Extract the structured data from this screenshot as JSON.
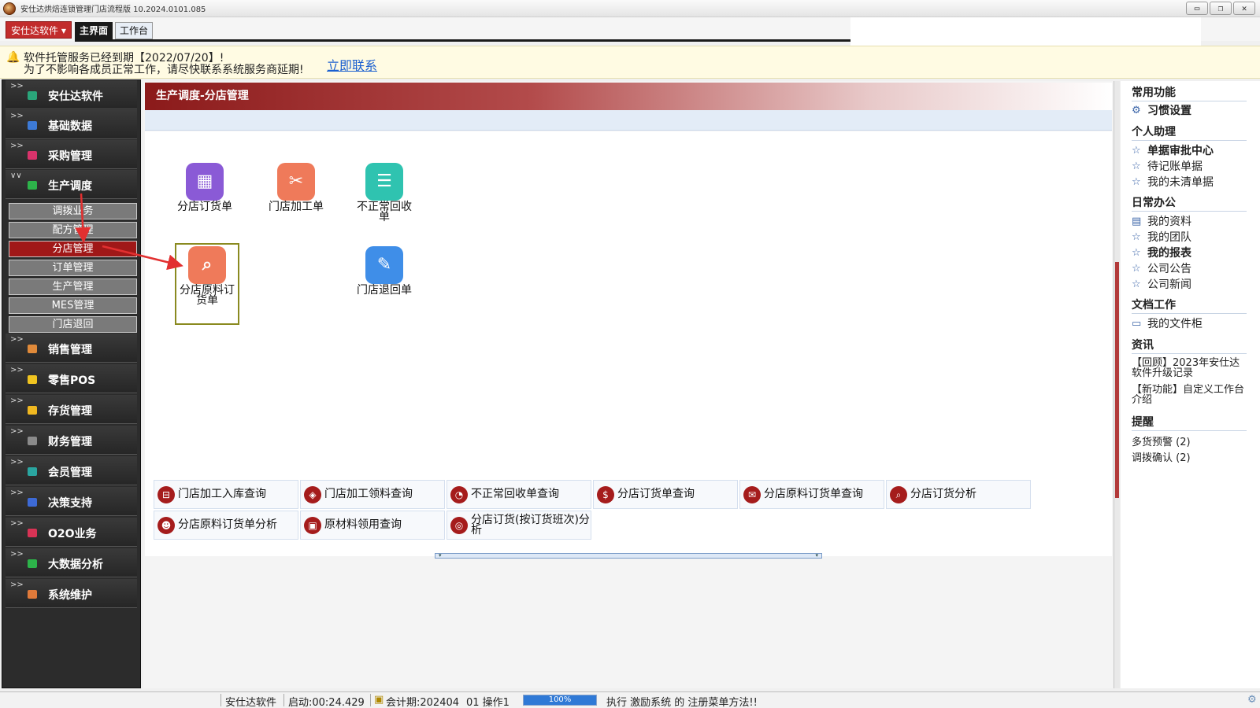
{
  "window": {
    "title": "安仕达烘焙连锁管理门店流程版  10.2024.0101.085",
    "controls": {
      "minimize": "▭",
      "restore": "❐",
      "close": "✕"
    }
  },
  "tabbar": {
    "brand_button": "安仕达软件 ▾",
    "tabs": [
      "主界面",
      "工作台"
    ]
  },
  "notice": {
    "line1": "软件托管服务已经到期【2022/07/20】!",
    "line2": "为了不影响各成员正常工作，请尽快联系系统服务商延期!",
    "link": "立即联系"
  },
  "sidebar": {
    "items": [
      {
        "label": "安仕达软件",
        "color": "#2aa57a"
      },
      {
        "label": "基础数据",
        "color": "#3d7ad6"
      },
      {
        "label": "采购管理",
        "color": "#d8336b"
      },
      {
        "label": "生产调度",
        "color": "#2db34a"
      },
      {
        "label": "销售管理",
        "color": "#e08a3a"
      },
      {
        "label": "零售POS",
        "color": "#f0c420"
      },
      {
        "label": "存货管理",
        "color": "#f0b820"
      },
      {
        "label": "财务管理",
        "color": "#8a8a8a"
      },
      {
        "label": "会员管理",
        "color": "#2aa5a0"
      },
      {
        "label": "决策支持",
        "color": "#3d6ad6"
      },
      {
        "label": "O2O业务",
        "color": "#d83355"
      },
      {
        "label": "大数据分析",
        "color": "#2db34a"
      },
      {
        "label": "系统维护",
        "color": "#e07a3a"
      }
    ],
    "subitems": [
      "调拨业务",
      "配方管理",
      "分店管理",
      "订单管理",
      "生产管理",
      "MES管理",
      "门店退回"
    ],
    "active_subitem": "分店管理"
  },
  "content": {
    "header": "生产调度-分店管理",
    "tiles": [
      {
        "label": "分店订货单",
        "icon": "calculator-icon",
        "color": "#8a5ad6",
        "glyph": "▦"
      },
      {
        "label": "门店加工单",
        "icon": "folder-tools-icon",
        "color": "#ef7a5a",
        "glyph": "✂"
      },
      {
        "label": "不正常回收单",
        "icon": "folder-list-icon",
        "color": "#2fc3b0",
        "glyph": "☰"
      },
      {
        "label": "分店原料订货单",
        "icon": "document-search-icon",
        "color": "#ef7a5a",
        "glyph": "⌕"
      },
      {
        "label": "门店退回单",
        "icon": "edit-doc-icon",
        "color": "#3f8ee8",
        "glyph": "✎"
      }
    ],
    "quick": [
      {
        "label": "门店加工入库查询",
        "glyph": "⊟"
      },
      {
        "label": "门店加工领料查询",
        "glyph": "◈"
      },
      {
        "label": "不正常回收单查询",
        "glyph": "◔"
      },
      {
        "label": "分店订货单查询",
        "glyph": "$"
      },
      {
        "label": "分店原料订货单查询",
        "glyph": "✉"
      },
      {
        "label": "分店订货分析",
        "glyph": "⌕"
      },
      {
        "label": "分店原料订货单分析",
        "glyph": "☻"
      },
      {
        "label": "原材料领用查询",
        "glyph": "▣"
      },
      {
        "label": "分店订货(按订货班次)分析",
        "glyph": "◎"
      }
    ]
  },
  "rpanel": {
    "sections": {
      "common": "常用功能",
      "assistant": "个人助理",
      "office": "日常办公",
      "docs": "文档工作",
      "news": "资讯",
      "remind": "提醒"
    },
    "common_items": [
      "习惯设置"
    ],
    "assistant_items": [
      "单据审批中心",
      "待记账单据",
      "我的未清单据"
    ],
    "office_items": [
      "我的资料",
      "我的团队",
      "我的报表",
      "公司公告",
      "公司新闻"
    ],
    "docs_items": [
      "我的文件柜"
    ],
    "news_items": [
      "【回顾】2023年安仕达软件升级记录",
      "【新功能】自定义工作台介绍"
    ],
    "remind_items": [
      "多货预警 (2)",
      "调拨确认 (2)"
    ]
  },
  "status": {
    "company": "安仕达软件",
    "startup": "启动:00:24.429",
    "period": "会计期:202404",
    "op": "01 操作1",
    "progress": 1.0,
    "progress_text": "100%",
    "message": "执行 激励系统 的 注册菜单方法!!"
  }
}
